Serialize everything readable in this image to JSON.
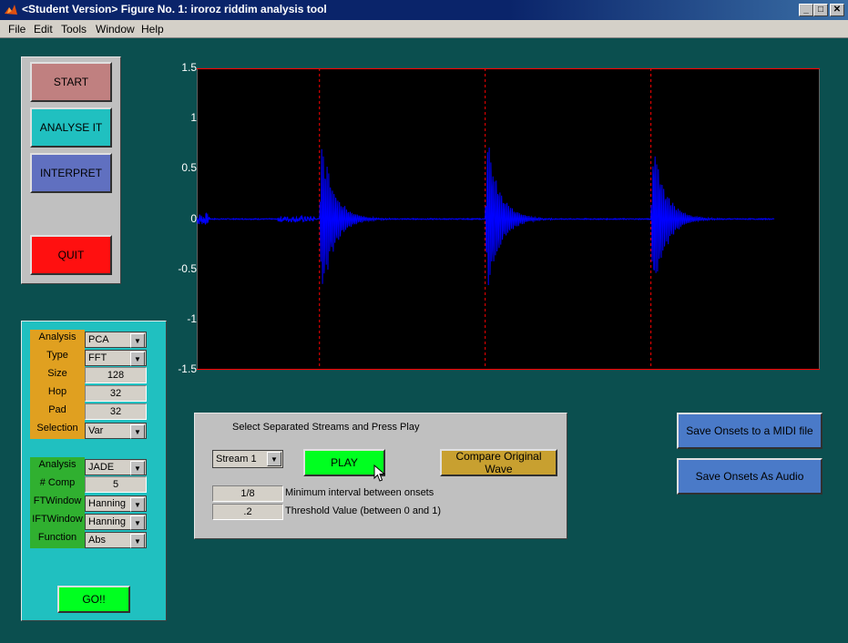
{
  "window": {
    "title": "<Student Version> Figure No. 1: iroroz riddim analysis tool"
  },
  "menu": [
    "File",
    "Edit",
    "Tools",
    "Window",
    "Help"
  ],
  "main_buttons": {
    "start": "START",
    "analyse": "ANALYSE IT",
    "interpret": "INTERPRET",
    "quit": "QUIT"
  },
  "params1": {
    "analysis_label": "Analysis",
    "analysis_value": "PCA",
    "type_label": "Type",
    "type_value": "FFT",
    "size_label": "Size",
    "size_value": "128",
    "hop_label": "Hop",
    "hop_value": "32",
    "pad_label": "Pad",
    "pad_value": "32",
    "selection_label": "Selection",
    "selection_value": "Var"
  },
  "params2": {
    "analysis_label": "Analysis",
    "analysis_value": "JADE",
    "comp_label": "# Comp",
    "comp_value": "5",
    "ftwindow_label": "FTWindow",
    "ftwindow_value": "Hanning",
    "iftwindow_label": "IFTWindow",
    "iftwindow_value": "Hanning",
    "function_label": "Function",
    "function_value": "Abs"
  },
  "go_button": "GO!!",
  "stream_panel": {
    "heading": "Select Separated Streams and Press Play",
    "stream_value": "Stream 1",
    "play_label": "PLAY",
    "compare_label": "Compare Original Wave",
    "interval_value": "1/8",
    "interval_label": "Minimum interval between onsets",
    "threshold_value": ".2",
    "threshold_label": "Threshold Value (between 0 and 1)"
  },
  "save_buttons": {
    "midi": "Save Onsets to a MIDI file",
    "audio": "Save Onsets As Audio"
  },
  "chart_data": {
    "type": "line",
    "ylim": [
      -1.5,
      1.5
    ],
    "xlim": [
      0,
      1
    ],
    "yticks": [
      "1.5",
      "1",
      "0.5",
      "0",
      "-0.5",
      "-1",
      "-1.5"
    ],
    "onset_markers": [
      0.197,
      0.463,
      0.729
    ],
    "series": [
      {
        "color": "#0000ff",
        "bursts": [
          {
            "start": 0.197,
            "peak": 1.0,
            "length": 0.08
          },
          {
            "start": 0.463,
            "peak": 1.0,
            "length": 0.08
          },
          {
            "start": 0.729,
            "peak": 1.0,
            "length": 0.08
          }
        ],
        "end": 0.927
      }
    ],
    "background": "#000000",
    "marker_color": "#ff0000"
  },
  "colors": {
    "figure_bg": "#0b4f4f",
    "start": "#c08080",
    "analyse": "#20c0c0",
    "interpret": "#6070c0",
    "quit": "#ff1010",
    "orange": "#e0a020",
    "green": "#30b030",
    "cyan": "#20c0c0",
    "bright_green": "#00ff20",
    "olive": "#c8a030",
    "blue_btn": "#4a7ac8"
  }
}
